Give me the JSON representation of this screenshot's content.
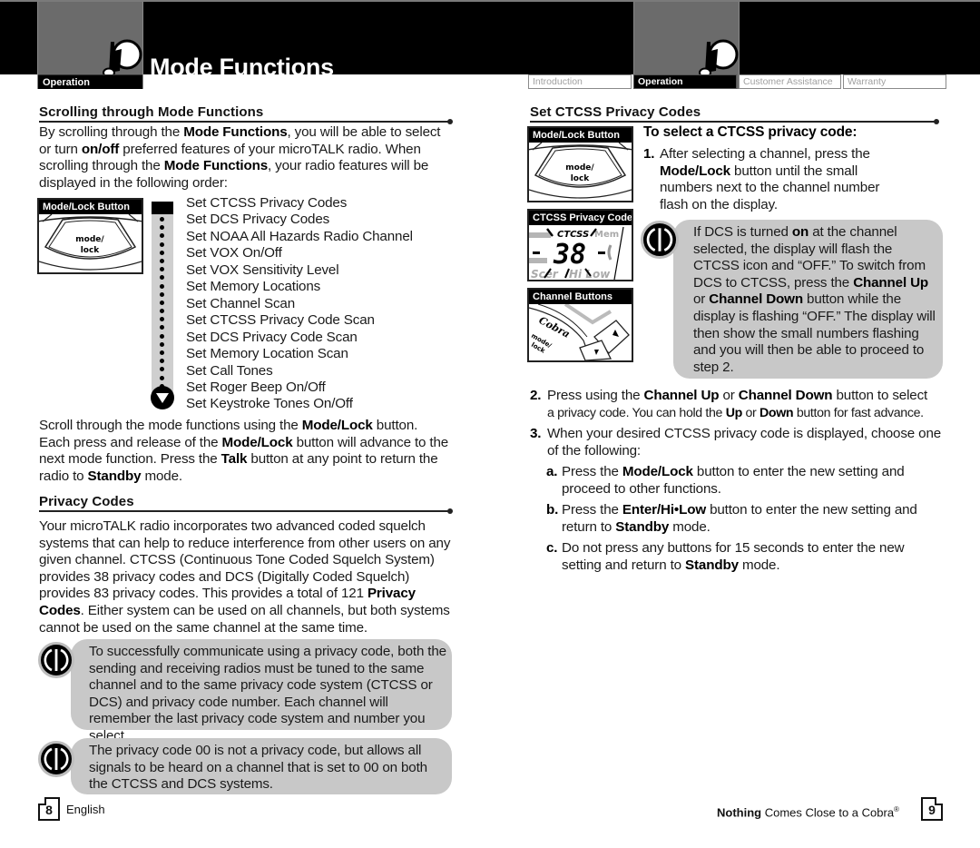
{
  "header": {
    "left_tab_label": "Operation",
    "page_title": "Mode Functions",
    "nav_tabs": [
      {
        "label": "Introduction",
        "active": false
      },
      {
        "label": "Operation",
        "active": true
      },
      {
        "label": "Customer Assistance",
        "active": false
      },
      {
        "label": "Warranty",
        "active": false
      }
    ],
    "icon": "walkie-talkie-icon"
  },
  "left_page": {
    "scrolling": {
      "heading": "Scrolling through Mode Functions",
      "intro": [
        {
          "t": "By scrolling through the "
        },
        {
          "b": "Mode Functions"
        },
        {
          "t": ", you will be able to select or turn "
        },
        {
          "b": "on/off"
        },
        {
          "t": " preferred features of your microTALK radio. When scrolling through the "
        },
        {
          "b": "Mode Functions"
        },
        {
          "t": ", your radio features will be displayed in the following order:"
        }
      ],
      "illustration_caption": "Mode/Lock Button",
      "button_face_label_1": "mode/",
      "button_face_label_2": "lock",
      "mode_list": [
        "Set CTCSS Privacy Codes",
        "Set DCS Privacy Codes",
        "Set NOAA All Hazards Radio Channel",
        "Set VOX On/Off",
        "Set VOX Sensitivity Level",
        "Set Memory Locations",
        "Set Channel Scan",
        "Set CTCSS Privacy Code Scan",
        "Set DCS Privacy Code Scan",
        "Set Memory Location Scan",
        "Set Call Tones",
        "Set Roger Beep On/Off",
        "Set Keystroke Tones On/Off"
      ],
      "outro": [
        {
          "t": "Scroll through the mode functions using the "
        },
        {
          "b": "Mode/Lock"
        },
        {
          "t": " button. Each press and release of the "
        },
        {
          "b": "Mode/Lock"
        },
        {
          "t": " button will advance to the next mode function. Press the "
        },
        {
          "b": "Talk"
        },
        {
          "t": " button at any point to return the radio to "
        },
        {
          "b": "Standby"
        },
        {
          "t": " mode."
        }
      ]
    },
    "privacy": {
      "heading": "Privacy Codes",
      "body": [
        {
          "t": "Your microTALK radio incorporates two advanced coded squelch systems that can help to reduce interference from other users on any given channel. CTCSS (Continuous Tone Coded Squelch System) provides 38 privacy codes and DCS (Digitally Coded Squelch) provides 83 privacy codes. This provides a total of 121 "
        },
        {
          "b": "Privacy Codes"
        },
        {
          "t": ". Either system can be used on all channels, but both systems cannot be used on the same channel at the same time."
        }
      ],
      "notes": [
        "To successfully communicate using a privacy code, both the sending and receiving radios must be tuned to the same channel and to the same privacy code system (CTCSS or DCS) and privacy code number. Each channel will remember the last privacy code system and number you select.",
        "The privacy code 00 is not a privacy code, but allows all signals to be heard on a channel that is set to 00 on both the CTCSS and DCS systems."
      ]
    },
    "footer": {
      "page_number": "8",
      "language": "English"
    }
  },
  "right_page": {
    "heading": "Set CTCSS Privacy Codes",
    "illustrations": {
      "mode_lock_caption": "Mode/Lock Button",
      "button_face_label_1": "mode/",
      "button_face_label_2": "lock",
      "ctcss_caption": "CTCSS Privacy Code",
      "lcd_icon_text": "CTCSS",
      "lcd_channel": "38",
      "lcd_bottom_left": "Scer",
      "lcd_bottom_right": "Hi Low",
      "channel_caption": "Channel Buttons",
      "brand": "Cobra"
    },
    "subheading": "To select a CTCSS privacy code:",
    "step1": {
      "num": "1.",
      "text": [
        {
          "t": "After selecting a channel, press the "
        },
        {
          "b": "Mode/Lock"
        },
        {
          "t": " button until the small numbers next to the channel number flash on the display."
        }
      ]
    },
    "note": [
      {
        "t": "If DCS is turned "
      },
      {
        "b": "on"
      },
      {
        "t": " at the channel selected, the display will flash the CTCSS icon and “OFF.” To switch from DCS to CTCSS, press the "
      },
      {
        "b": "Channel Up"
      },
      {
        "t": " or "
      },
      {
        "b": "Channel Down"
      },
      {
        "t": " button while the display is flashing “OFF.” The display will then show the small numbers flashing and you will then be able to proceed to step 2."
      }
    ],
    "step2": {
      "num": "2.",
      "line1": [
        {
          "t": "Press using the "
        },
        {
          "b": "Channel Up"
        },
        {
          "t": " or "
        },
        {
          "b": "Channel Down"
        },
        {
          "t": " button to select"
        }
      ],
      "line2": [
        {
          "t": "a privacy code. You can hold the "
        },
        {
          "b": "Up"
        },
        {
          "t": " or "
        },
        {
          "b": "Down"
        },
        {
          "t": " button for fast advance."
        }
      ]
    },
    "step3": {
      "num": "3.",
      "text": [
        {
          "t": "When your desired CTCSS privacy code is displayed, choose one of the following:"
        }
      ]
    },
    "substeps": [
      {
        "label": "a.",
        "text": [
          {
            "t": "Press the "
          },
          {
            "b": "Mode/Lock"
          },
          {
            "t": " button to enter the new setting and proceed to other functions."
          }
        ]
      },
      {
        "label": "b.",
        "text": [
          {
            "t": "Press the "
          },
          {
            "b": "Enter/Hi•Low"
          },
          {
            "t": " button to enter the new setting and return to "
          },
          {
            "b": "Standby"
          },
          {
            "t": " mode."
          }
        ]
      },
      {
        "label": "c.",
        "text": [
          {
            "t": "Do not press any buttons for 15 seconds to enter the new setting and return to "
          },
          {
            "b": "Standby"
          },
          {
            "t": " mode."
          }
        ]
      }
    ],
    "footer": {
      "tagline_bold": "Nothing",
      "tagline_rest": " Comes Close to a Cobra",
      "registered": "®",
      "page_number": "9"
    }
  }
}
